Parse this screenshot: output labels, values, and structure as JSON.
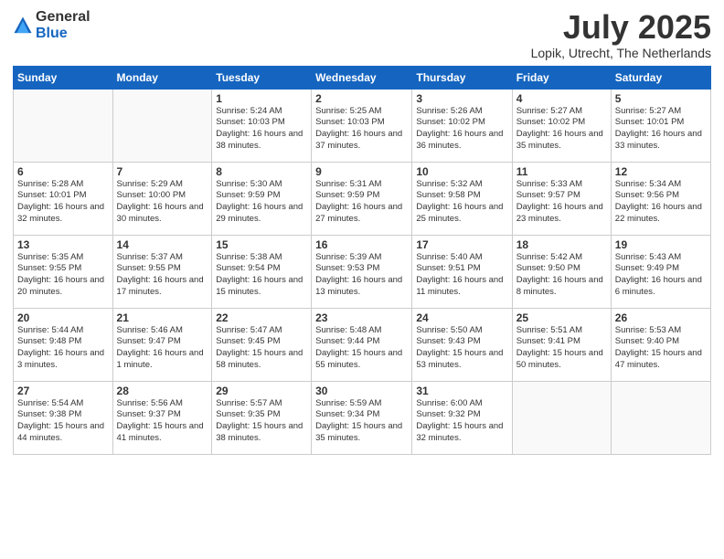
{
  "logo": {
    "general": "General",
    "blue": "Blue"
  },
  "title": "July 2025",
  "subtitle": "Lopik, Utrecht, The Netherlands",
  "headers": [
    "Sunday",
    "Monday",
    "Tuesday",
    "Wednesday",
    "Thursday",
    "Friday",
    "Saturday"
  ],
  "weeks": [
    [
      {
        "num": "",
        "info": ""
      },
      {
        "num": "",
        "info": ""
      },
      {
        "num": "1",
        "info": "Sunrise: 5:24 AM\nSunset: 10:03 PM\nDaylight: 16 hours\nand 38 minutes."
      },
      {
        "num": "2",
        "info": "Sunrise: 5:25 AM\nSunset: 10:03 PM\nDaylight: 16 hours\nand 37 minutes."
      },
      {
        "num": "3",
        "info": "Sunrise: 5:26 AM\nSunset: 10:02 PM\nDaylight: 16 hours\nand 36 minutes."
      },
      {
        "num": "4",
        "info": "Sunrise: 5:27 AM\nSunset: 10:02 PM\nDaylight: 16 hours\nand 35 minutes."
      },
      {
        "num": "5",
        "info": "Sunrise: 5:27 AM\nSunset: 10:01 PM\nDaylight: 16 hours\nand 33 minutes."
      }
    ],
    [
      {
        "num": "6",
        "info": "Sunrise: 5:28 AM\nSunset: 10:01 PM\nDaylight: 16 hours\nand 32 minutes."
      },
      {
        "num": "7",
        "info": "Sunrise: 5:29 AM\nSunset: 10:00 PM\nDaylight: 16 hours\nand 30 minutes."
      },
      {
        "num": "8",
        "info": "Sunrise: 5:30 AM\nSunset: 9:59 PM\nDaylight: 16 hours\nand 29 minutes."
      },
      {
        "num": "9",
        "info": "Sunrise: 5:31 AM\nSunset: 9:59 PM\nDaylight: 16 hours\nand 27 minutes."
      },
      {
        "num": "10",
        "info": "Sunrise: 5:32 AM\nSunset: 9:58 PM\nDaylight: 16 hours\nand 25 minutes."
      },
      {
        "num": "11",
        "info": "Sunrise: 5:33 AM\nSunset: 9:57 PM\nDaylight: 16 hours\nand 23 minutes."
      },
      {
        "num": "12",
        "info": "Sunrise: 5:34 AM\nSunset: 9:56 PM\nDaylight: 16 hours\nand 22 minutes."
      }
    ],
    [
      {
        "num": "13",
        "info": "Sunrise: 5:35 AM\nSunset: 9:55 PM\nDaylight: 16 hours\nand 20 minutes."
      },
      {
        "num": "14",
        "info": "Sunrise: 5:37 AM\nSunset: 9:55 PM\nDaylight: 16 hours\nand 17 minutes."
      },
      {
        "num": "15",
        "info": "Sunrise: 5:38 AM\nSunset: 9:54 PM\nDaylight: 16 hours\nand 15 minutes."
      },
      {
        "num": "16",
        "info": "Sunrise: 5:39 AM\nSunset: 9:53 PM\nDaylight: 16 hours\nand 13 minutes."
      },
      {
        "num": "17",
        "info": "Sunrise: 5:40 AM\nSunset: 9:51 PM\nDaylight: 16 hours\nand 11 minutes."
      },
      {
        "num": "18",
        "info": "Sunrise: 5:42 AM\nSunset: 9:50 PM\nDaylight: 16 hours\nand 8 minutes."
      },
      {
        "num": "19",
        "info": "Sunrise: 5:43 AM\nSunset: 9:49 PM\nDaylight: 16 hours\nand 6 minutes."
      }
    ],
    [
      {
        "num": "20",
        "info": "Sunrise: 5:44 AM\nSunset: 9:48 PM\nDaylight: 16 hours\nand 3 minutes."
      },
      {
        "num": "21",
        "info": "Sunrise: 5:46 AM\nSunset: 9:47 PM\nDaylight: 16 hours\nand 1 minute."
      },
      {
        "num": "22",
        "info": "Sunrise: 5:47 AM\nSunset: 9:45 PM\nDaylight: 15 hours\nand 58 minutes."
      },
      {
        "num": "23",
        "info": "Sunrise: 5:48 AM\nSunset: 9:44 PM\nDaylight: 15 hours\nand 55 minutes."
      },
      {
        "num": "24",
        "info": "Sunrise: 5:50 AM\nSunset: 9:43 PM\nDaylight: 15 hours\nand 53 minutes."
      },
      {
        "num": "25",
        "info": "Sunrise: 5:51 AM\nSunset: 9:41 PM\nDaylight: 15 hours\nand 50 minutes."
      },
      {
        "num": "26",
        "info": "Sunrise: 5:53 AM\nSunset: 9:40 PM\nDaylight: 15 hours\nand 47 minutes."
      }
    ],
    [
      {
        "num": "27",
        "info": "Sunrise: 5:54 AM\nSunset: 9:38 PM\nDaylight: 15 hours\nand 44 minutes."
      },
      {
        "num": "28",
        "info": "Sunrise: 5:56 AM\nSunset: 9:37 PM\nDaylight: 15 hours\nand 41 minutes."
      },
      {
        "num": "29",
        "info": "Sunrise: 5:57 AM\nSunset: 9:35 PM\nDaylight: 15 hours\nand 38 minutes."
      },
      {
        "num": "30",
        "info": "Sunrise: 5:59 AM\nSunset: 9:34 PM\nDaylight: 15 hours\nand 35 minutes."
      },
      {
        "num": "31",
        "info": "Sunrise: 6:00 AM\nSunset: 9:32 PM\nDaylight: 15 hours\nand 32 minutes."
      },
      {
        "num": "",
        "info": ""
      },
      {
        "num": "",
        "info": ""
      }
    ]
  ]
}
